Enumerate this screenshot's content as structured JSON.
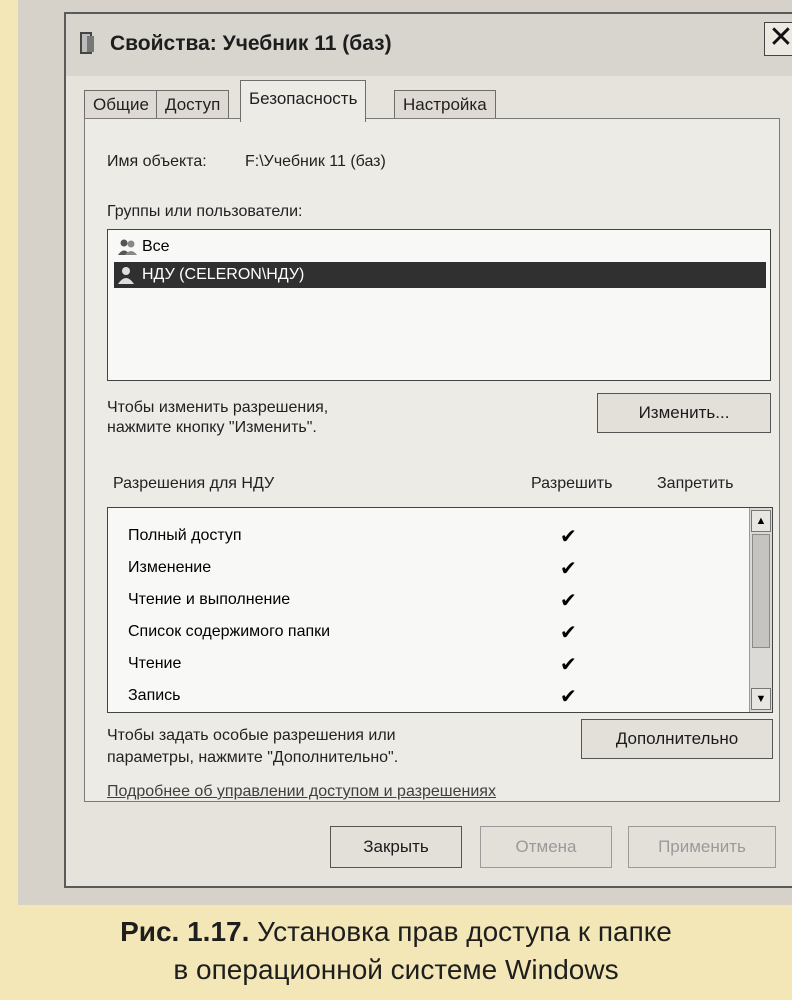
{
  "window": {
    "title": "Свойства: Учебник 11 (баз)",
    "close_glyph": "✕",
    "tabs": [
      {
        "label": "Общие"
      },
      {
        "label": "Доступ"
      },
      {
        "label": "Безопасность"
      },
      {
        "label": "Настройка"
      }
    ],
    "active_tab": "Безопасность"
  },
  "security": {
    "object_label": "Имя объекта:",
    "object_value": "F:\\Учебник 11 (баз)",
    "groups_label": "Группы или пользователи:",
    "groups": [
      {
        "icon": "group-icon",
        "label": "Все",
        "selected": false
      },
      {
        "icon": "user-icon",
        "label": "НДУ (CELERON\\НДУ)",
        "selected": true
      }
    ],
    "change_hint_line1": "Чтобы изменить разрешения,",
    "change_hint_line2": "нажмите кнопку \"Изменить\".",
    "change_button": "Изменить...",
    "permissions_for": "Разрешения для НДУ",
    "allow_header": "Разрешить",
    "deny_header": "Запретить",
    "permissions": [
      {
        "name": "Полный доступ",
        "allow": "✔",
        "deny": ""
      },
      {
        "name": "Изменение",
        "allow": "✔",
        "deny": ""
      },
      {
        "name": "Чтение и выполнение",
        "allow": "✔",
        "deny": ""
      },
      {
        "name": "Список содержимого папки",
        "allow": "✔",
        "deny": ""
      },
      {
        "name": "Чтение",
        "allow": "✔",
        "deny": ""
      },
      {
        "name": "Запись",
        "allow": "✔",
        "deny": ""
      }
    ],
    "advanced_hint_line1": "Чтобы задать особые разрешения или",
    "advanced_hint_line2": "параметры, нажмите \"Дополнительно\".",
    "advanced_button": "Дополнительно",
    "learn_more_link": "Подробнее об управлении доступом и разрешениях"
  },
  "footer": {
    "close_button": "Закрыть",
    "cancel_button": "Отмена",
    "apply_button": "Применить"
  },
  "caption": {
    "figure_label": "Рис. 1.17.",
    "line1": "Установка прав доступа к папке",
    "line2": "в операционной системе Windows"
  }
}
